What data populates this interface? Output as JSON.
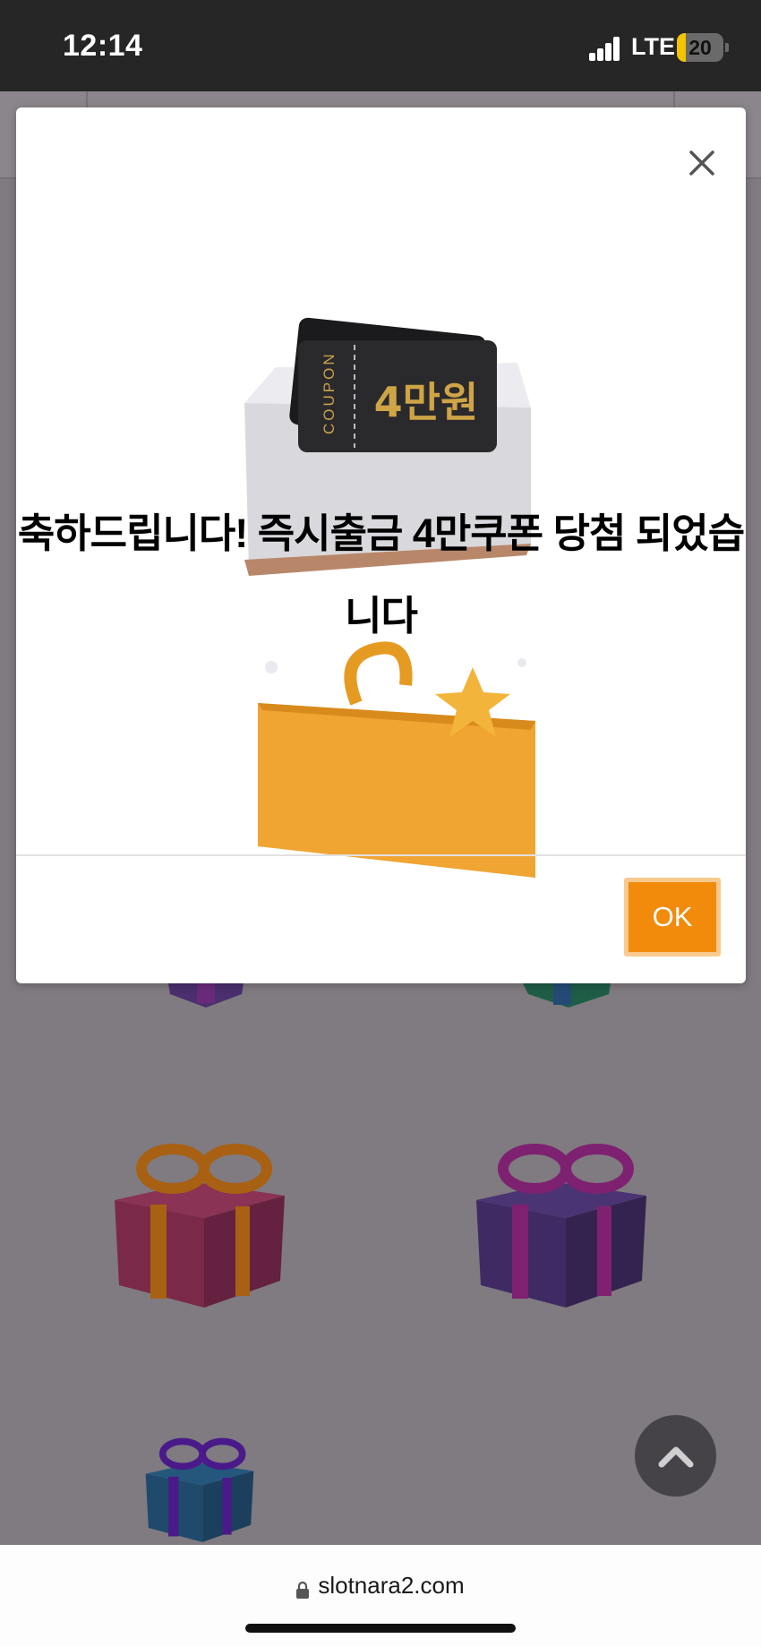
{
  "status_bar": {
    "time": "12:14",
    "network": "LTE",
    "battery_level": "20",
    "battery_fraction": 0.2
  },
  "modal": {
    "message": "축하드립니다! 즉시출금 4만쿠폰 당첨 되었습니다",
    "coupon_side_text": "COUPON",
    "coupon_amount": "4만원",
    "ok_label": "OK",
    "close_icon": "close-icon"
  },
  "background_gifts": [
    {
      "box_color": "#7a2a48",
      "ribbon_color": "#a86012"
    },
    {
      "box_color": "#3f2a63",
      "ribbon_color": "#7e2170"
    },
    {
      "box_color": "#1f4a6b",
      "ribbon_color": "#4a1a8a"
    }
  ],
  "browser": {
    "url": "slotnara2.com"
  },
  "colors": {
    "accent": "#f28a0c",
    "overlay": "#7f7b80"
  }
}
